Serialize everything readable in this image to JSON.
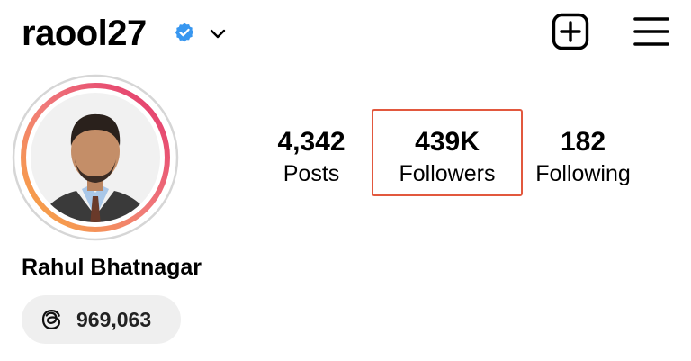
{
  "header": {
    "username": "raool27",
    "verified": true,
    "icons": {
      "verified": "verified-badge-icon",
      "dropdown": "chevron-down-icon",
      "create": "plus-square-icon",
      "menu": "hamburger-menu-icon"
    }
  },
  "profile": {
    "full_name": "Rahul Bhatnagar",
    "avatar": "profile-photo"
  },
  "stats": {
    "posts": {
      "value": "4,342",
      "label": "Posts"
    },
    "followers": {
      "value": "439K",
      "label": "Followers"
    },
    "following": {
      "value": "182",
      "label": "Following"
    }
  },
  "threads": {
    "icon": "threads-icon",
    "count": "969,063"
  },
  "colors": {
    "highlight_border": "#e2583e",
    "verified_blue": "#3897f0",
    "pill_bg": "#efefef"
  }
}
